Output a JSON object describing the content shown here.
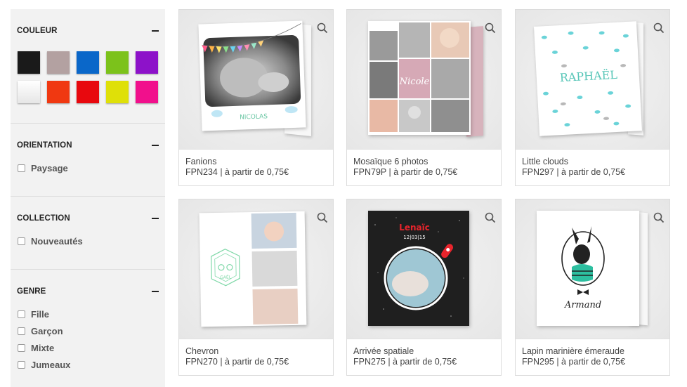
{
  "filters": {
    "couleur": {
      "title": "COULEUR",
      "swatches": [
        {
          "name": "noir",
          "color": "#1a1a1a"
        },
        {
          "name": "taupe",
          "color": "#b3a1a1"
        },
        {
          "name": "bleu",
          "color": "#0a67c9"
        },
        {
          "name": "vert",
          "color": "#7cc21b"
        },
        {
          "name": "violet",
          "color": "#8d12c9"
        },
        {
          "name": "blanc",
          "color": "#f4f4f4"
        },
        {
          "name": "orange",
          "color": "#f03811"
        },
        {
          "name": "rouge",
          "color": "#e8080e"
        },
        {
          "name": "jaune",
          "color": "#dfe008"
        },
        {
          "name": "rose",
          "color": "#f1108c"
        }
      ]
    },
    "orientation": {
      "title": "ORIENTATION",
      "options": [
        "Paysage"
      ]
    },
    "collection": {
      "title": "COLLECTION",
      "options": [
        "Nouveautés"
      ]
    },
    "genre": {
      "title": "GENRE",
      "options": [
        "Fille",
        "Garçon",
        "Mixte",
        "Jumeaux"
      ]
    }
  },
  "products": [
    {
      "name": "Fanions",
      "meta": "FPN234 | à partir de 0,75€",
      "card_text": "NICOLAS"
    },
    {
      "name": "Mosaïque 6 photos",
      "meta": "FPN79P | à partir de 0,75€",
      "card_text": "Nicole"
    },
    {
      "name": "Little clouds",
      "meta": "FPN297 | à partir de 0,75€",
      "card_text": "RAPHAËL"
    },
    {
      "name": "Chevron",
      "meta": "FPN270 | à partir de 0,75€",
      "card_text": "GAËL"
    },
    {
      "name": "Arrivée spatiale",
      "meta": "FPN275 | à partir de 0,75€",
      "card_text": "Lenaïc",
      "card_date": "12|03|15"
    },
    {
      "name": "Lapin marinière émeraude",
      "meta": "FPN295 | à partir de 0,75€",
      "card_text": "Armand"
    }
  ]
}
